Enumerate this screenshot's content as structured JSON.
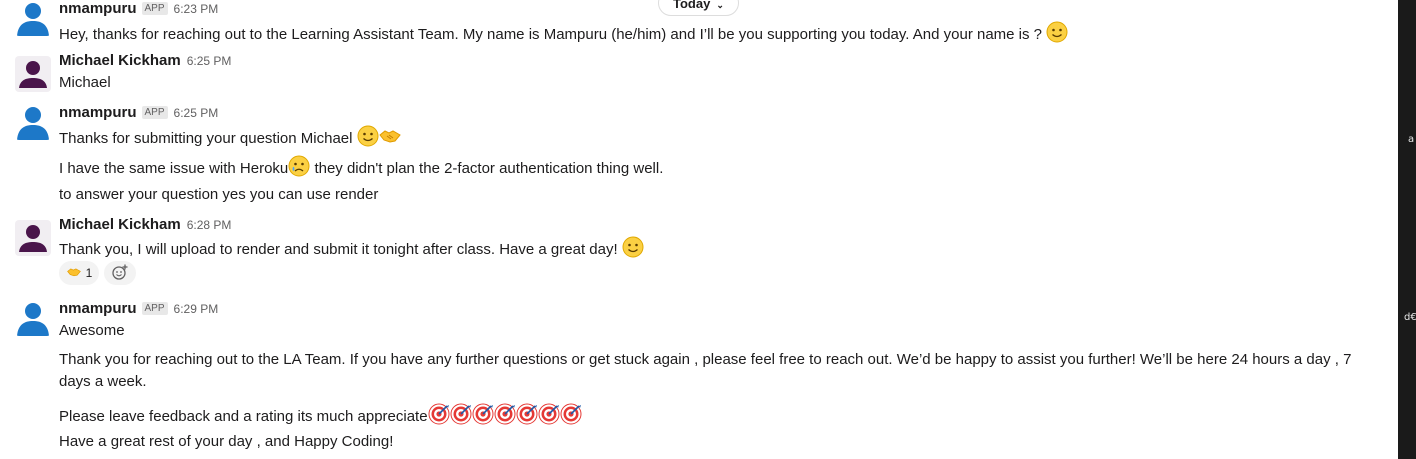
{
  "day_divider": {
    "label": "Today",
    "chevron_icon": "chevron-down-icon"
  },
  "messages": [
    {
      "author": "nmampuru",
      "badge": "APP",
      "time": "6:23 PM",
      "lines": [
        "Hey, thanks for reaching out to the Learning Assistant Team. My name is Mampuru (he/him) and I’ll be you supporting you today. And your name is ? "
      ]
    },
    {
      "author": "Michael Kickham",
      "time": "6:25 PM",
      "lines": [
        "Michael"
      ]
    },
    {
      "author": "nmampuru",
      "badge": "APP",
      "time": "6:25 PM",
      "lines": [
        "Thanks for submitting your question Michael ",
        "I have the same issue with Heroku",
        " they didn't plan the 2-factor authentication thing well.",
        "to answer your question yes you can use render"
      ]
    },
    {
      "author": "Michael Kickham",
      "time": "6:28 PM",
      "lines": [
        "Thank you, I will upload to render and submit it tonight after class. Have a great day! "
      ],
      "reactions": [
        {
          "emoji": "handshake-icon",
          "count": "1"
        }
      ],
      "add_reaction_icon": "add-reaction-icon"
    },
    {
      "author": "nmampuru",
      "badge": "APP",
      "time": "6:29 PM",
      "lines": [
        "Awesome",
        "Thank you for reaching out to the LA Team. If you have any further questions or get stuck again , please feel free to reach out. We’d be happy to assist you further! We’ll be here 24 hours a day , 7 days a week.",
        "Please leave feedback and a rating its much appreciate",
        " Have a great rest of your day , and Happy Coding!"
      ]
    }
  ],
  "right_panel_fragments": [
    "a",
    "d€"
  ],
  "colors": {
    "accent": "#1264a3",
    "bot_avatar": "#1d78c8",
    "human_avatar": "#4a154b",
    "reaction_bg": "#f3f3f3"
  }
}
